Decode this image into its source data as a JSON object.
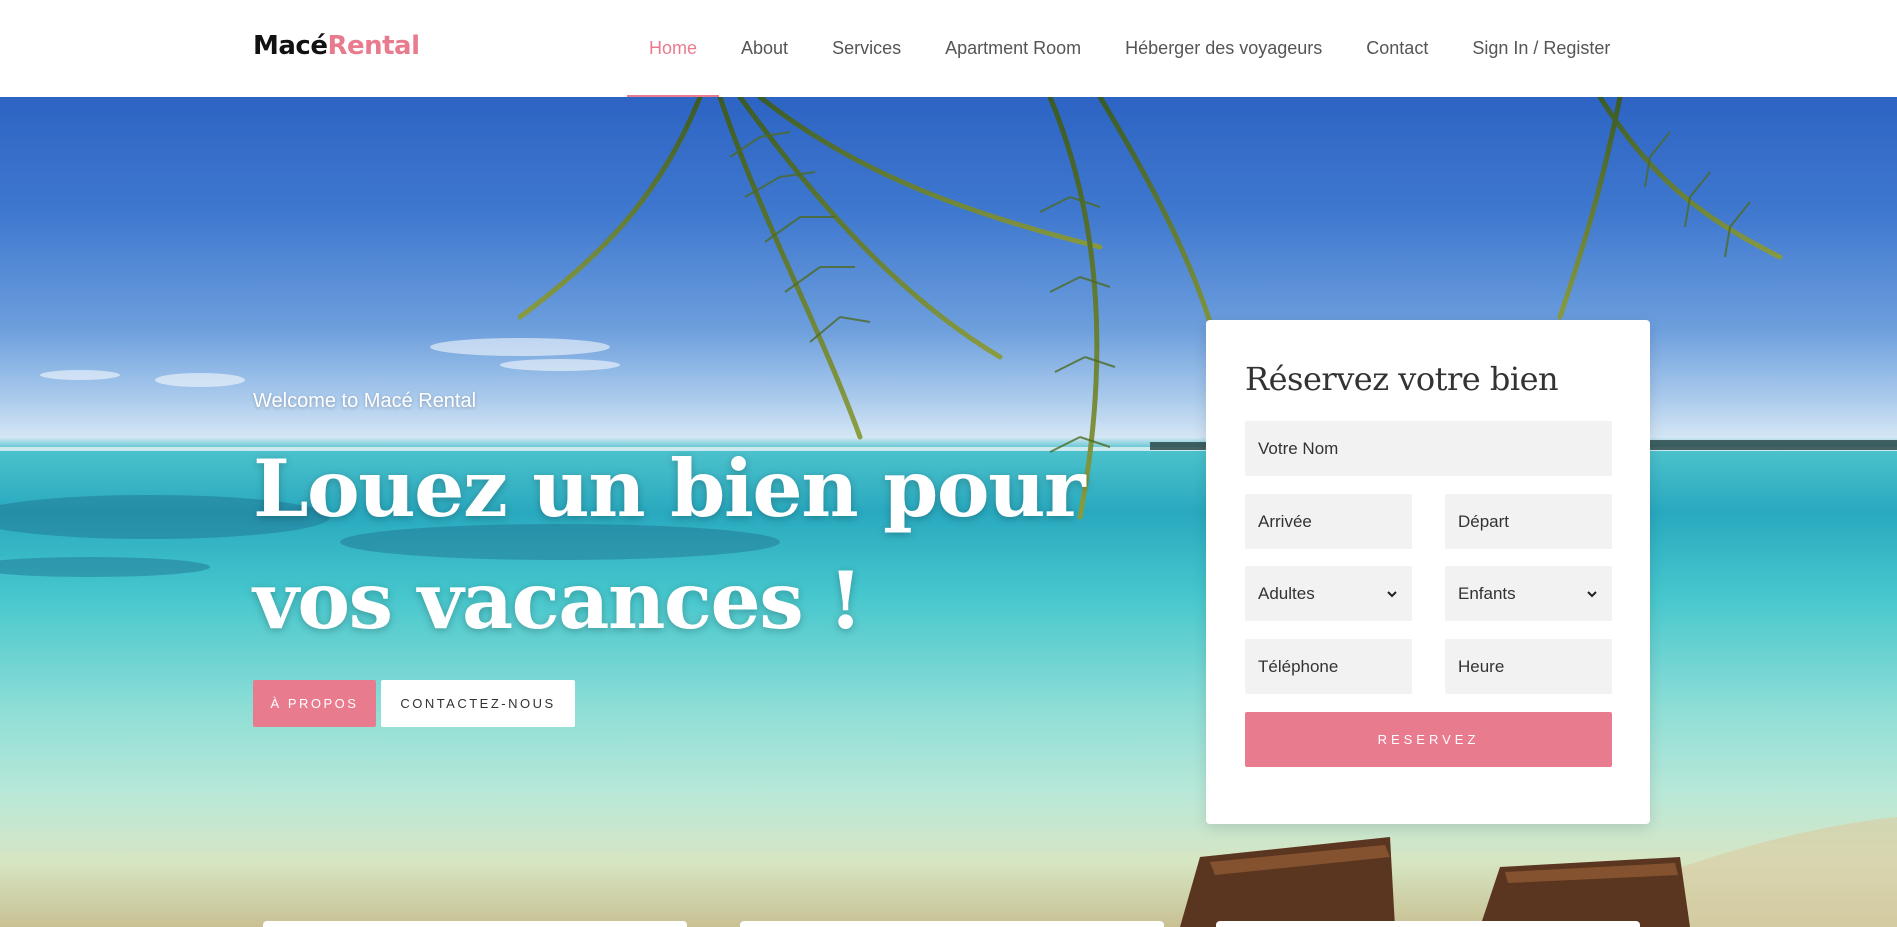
{
  "brand": {
    "part1": "Macé",
    "part2": "Rental"
  },
  "nav": {
    "items": [
      {
        "label": "Home",
        "active": true
      },
      {
        "label": "About"
      },
      {
        "label": "Services"
      },
      {
        "label": "Apartment Room"
      },
      {
        "label": "Héberger des voyageurs"
      },
      {
        "label": "Contact"
      },
      {
        "label": "Sign In / Register"
      }
    ]
  },
  "hero": {
    "welcome": "Welcome to Macé Rental",
    "headline_line1": "Louez un bien pour",
    "headline_line2": "vos vacances !",
    "btn_about": "À PROPOS",
    "btn_contact": "CONTACTEZ-NOUS"
  },
  "booking": {
    "title": "Réservez votre bien",
    "name_placeholder": "Votre Nom",
    "arrival_placeholder": "Arrivée",
    "departure_placeholder": "Départ",
    "adults_selected": "Adultes",
    "children_selected": "Enfants",
    "phone_placeholder": "Téléphone",
    "time_placeholder": "Heure",
    "submit_label": "RESERVEZ"
  },
  "colors": {
    "accent": "#e97b8f",
    "text_dark": "#111111",
    "nav_text": "#555555",
    "field_bg": "#f2f2f2"
  },
  "icons": [
    "chevron-down-icon"
  ]
}
